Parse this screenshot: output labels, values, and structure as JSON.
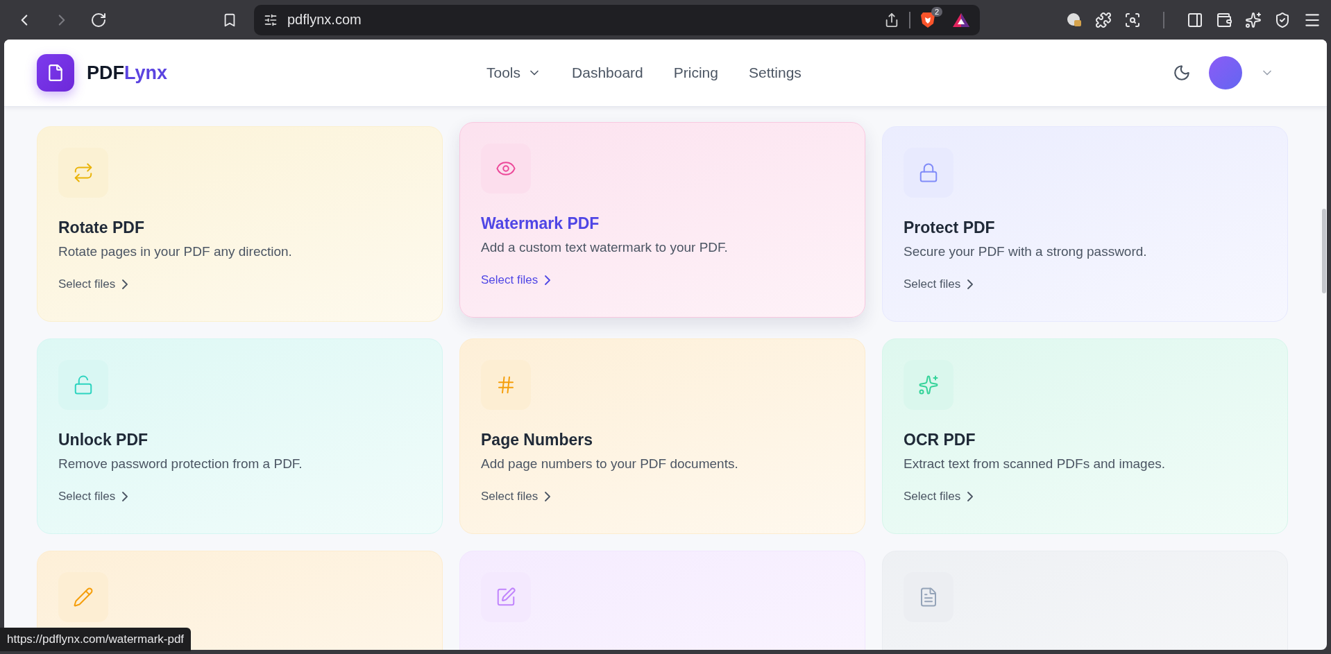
{
  "browser": {
    "url": "pdflynx.com",
    "back_disabled": false,
    "forward_disabled": true,
    "shields_count": "2",
    "status_url": "https://pdflynx.com/watermark-pdf"
  },
  "header": {
    "brand_prefix": "PDF",
    "brand_suffix": "Lynx",
    "nav": [
      {
        "label": "Tools",
        "has_menu": true
      },
      {
        "label": "Dashboard",
        "has_menu": false
      },
      {
        "label": "Pricing",
        "has_menu": false
      },
      {
        "label": "Settings",
        "has_menu": false
      }
    ]
  },
  "tools": [
    {
      "title": "Rotate PDF",
      "description": "Rotate pages in your PDF any direction.",
      "action": "Select files",
      "color": "#eab308",
      "hovered": false
    },
    {
      "title": "Watermark PDF",
      "description": "Add a custom text watermark to your PDF.",
      "action": "Select files",
      "color": "#ec4899",
      "hovered": true
    },
    {
      "title": "Protect PDF",
      "description": "Secure your PDF with a strong password.",
      "action": "Select files",
      "color": "#818cf8",
      "hovered": false
    },
    {
      "title": "Unlock PDF",
      "description": "Remove password protection from a PDF.",
      "action": "Select files",
      "color": "#2dd4bf",
      "hovered": false
    },
    {
      "title": "Page Numbers",
      "description": "Add page numbers to your PDF documents.",
      "action": "Select files",
      "color": "#f59e0b",
      "hovered": false
    },
    {
      "title": "OCR PDF",
      "description": "Extract text from scanned PDFs and images.",
      "action": "Select files",
      "color": "#34d399",
      "hovered": false
    },
    {
      "color": "#f59e0b",
      "hovered": false
    },
    {
      "color": "#c084fc",
      "hovered": false
    },
    {
      "color": "#94a3b8",
      "hovered": false
    }
  ]
}
